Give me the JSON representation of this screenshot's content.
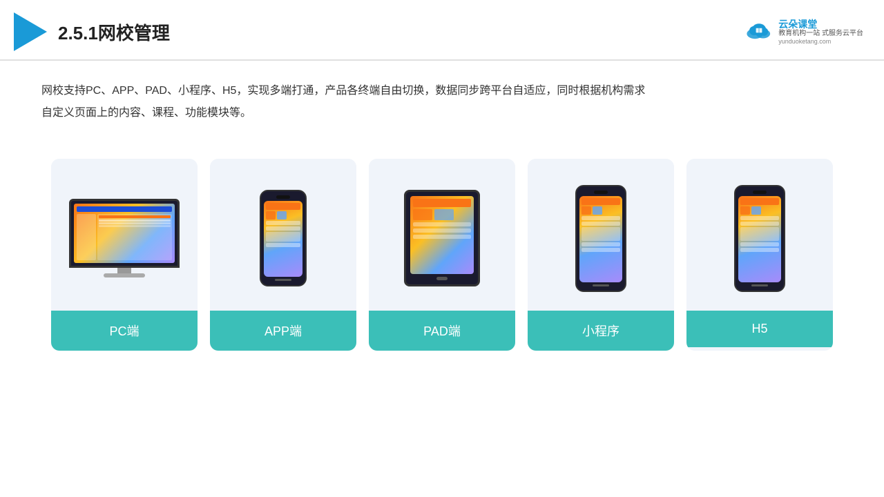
{
  "header": {
    "section_number": "2.5.1",
    "title": "网校管理",
    "brand": {
      "name": "云朵课堂",
      "url": "yunduoketang.com",
      "tagline1": "教育机构一站",
      "tagline2": "式服务云平台"
    }
  },
  "description": {
    "text": "网校支持PC、APP、PAD、小程序、H5，实现多端打通，产品各终端自由切换，数据同步跨平台自适应，同时根据机构需求自定义页面上的内容、课程、功能模块等。"
  },
  "cards": [
    {
      "id": "pc",
      "label": "PC端",
      "type": "pc"
    },
    {
      "id": "app",
      "label": "APP端",
      "type": "phone"
    },
    {
      "id": "pad",
      "label": "PAD端",
      "type": "tablet"
    },
    {
      "id": "miniapp",
      "label": "小程序",
      "type": "phone"
    },
    {
      "id": "h5",
      "label": "H5",
      "type": "phone"
    }
  ],
  "colors": {
    "accent": "#3bbfb8",
    "header_line": "#e0e0e0",
    "logo_blue": "#1a9ad7",
    "card_bg": "#f0f4fa"
  }
}
